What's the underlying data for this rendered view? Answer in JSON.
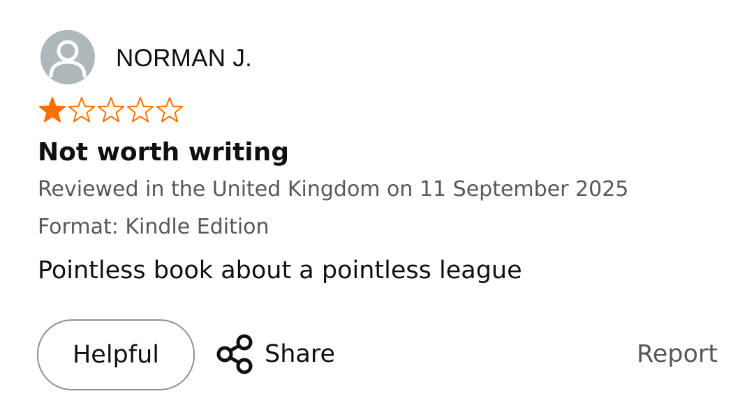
{
  "reviewer": {
    "name": "NORMAN J.",
    "avatar_icon": "default-user-icon"
  },
  "rating": {
    "value": 1,
    "max": 5,
    "filled_color": "#ff7000",
    "outline_color": "#ff7000"
  },
  "review": {
    "title": "Not worth writing",
    "location_date": "Reviewed in the United Kingdom on 11 September 2025",
    "format": "Format: Kindle Edition",
    "body": "Pointless book about a pointless league"
  },
  "actions": {
    "helpful_label": "Helpful",
    "share_label": "Share",
    "share_icon": "share-icon",
    "report_label": "Report"
  }
}
